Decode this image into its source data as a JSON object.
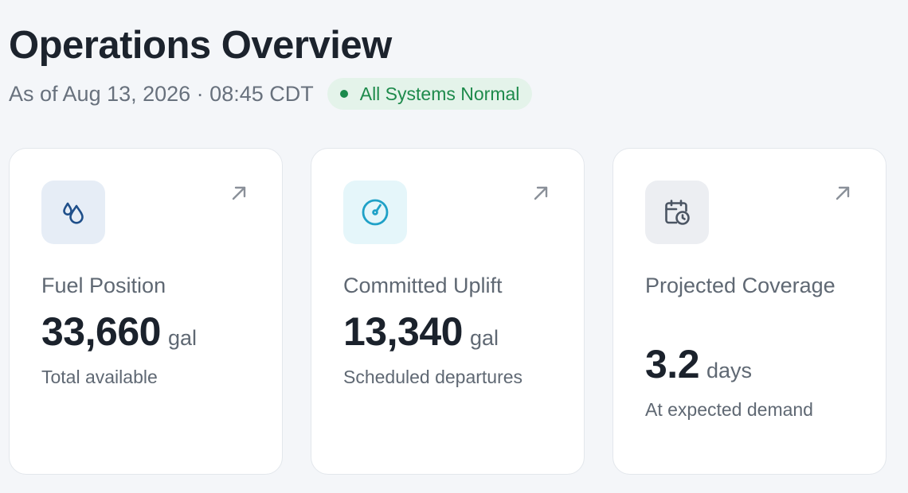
{
  "header": {
    "title": "Operations Overview",
    "timestamp": "As of Aug 13, 2026 · 08:45 CDT",
    "status": {
      "label": "All Systems Normal",
      "color": "#1b8a4c"
    }
  },
  "cards": [
    {
      "icon": "fuel-drops-icon",
      "icon_color": "#1f4f8a",
      "label": "Fuel Position",
      "value": "33,660",
      "unit": "gal",
      "caption": "Total available"
    },
    {
      "icon": "gauge-icon",
      "icon_color": "#1fa1c7",
      "label": "Committed Uplift",
      "value": "13,340",
      "unit": "gal",
      "caption": "Scheduled departures"
    },
    {
      "icon": "calendar-clock-icon",
      "icon_color": "#4b5563",
      "label": "Projected Coverage",
      "value": "3.2",
      "unit": "days",
      "caption": "At expected demand"
    }
  ],
  "link_icon": "external-arrow-icon"
}
